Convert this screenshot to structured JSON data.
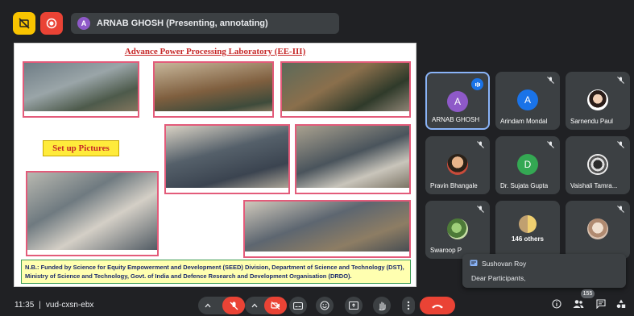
{
  "presenting_bar": {
    "avatar_initial": "A",
    "text": "ARNAB GHOSH (Presenting, annotating)"
  },
  "slide": {
    "title": "Advance Power Processing Laboratory (EE-III)",
    "setup_label": "Set up Pictures",
    "note": "N.B.: Funded by Science for Equity Empowerment and Development (SEED) Division, Department of Science and Technology (DST), Ministry of Science and Technology, Govt. of India and Defence Research and Development Organisation (DRDO)."
  },
  "participants": [
    {
      "name": "ARNAB GHOSH",
      "initial": "A",
      "color": "#8e59c8",
      "speaking": true
    },
    {
      "name": "Arindam Mondal",
      "initial": "A",
      "color": "#1a73e8",
      "speaking": false
    },
    {
      "name": "Sarnendu Paul",
      "initial": "",
      "color": "#ffffff",
      "speaking": false
    },
    {
      "name": "Pravin Bhangale",
      "initial": "",
      "color": "#e8b48a",
      "speaking": false
    },
    {
      "name": "Dr. Sujata Gupta",
      "initial": "D",
      "color": "#34a853",
      "speaking": false
    },
    {
      "name": "Vaishali Tamra...",
      "initial": "",
      "color": "#dddddd",
      "speaking": false
    },
    {
      "name": "Swaroop P",
      "initial": "",
      "color": "#7cae5a",
      "speaking": false
    },
    {
      "name": "146 others",
      "initial": "",
      "color": "#c0a070",
      "speaking": false
    },
    {
      "name": "",
      "initial": "",
      "color": "#d9c2b0",
      "speaking": false
    }
  ],
  "chat_toast": {
    "sender": "Sushovan Roy",
    "message": "Dear Participants,"
  },
  "bottom": {
    "time": "11:35",
    "separator": "|",
    "meeting_code": "vud-cxsn-ebx",
    "people_count": "155"
  }
}
